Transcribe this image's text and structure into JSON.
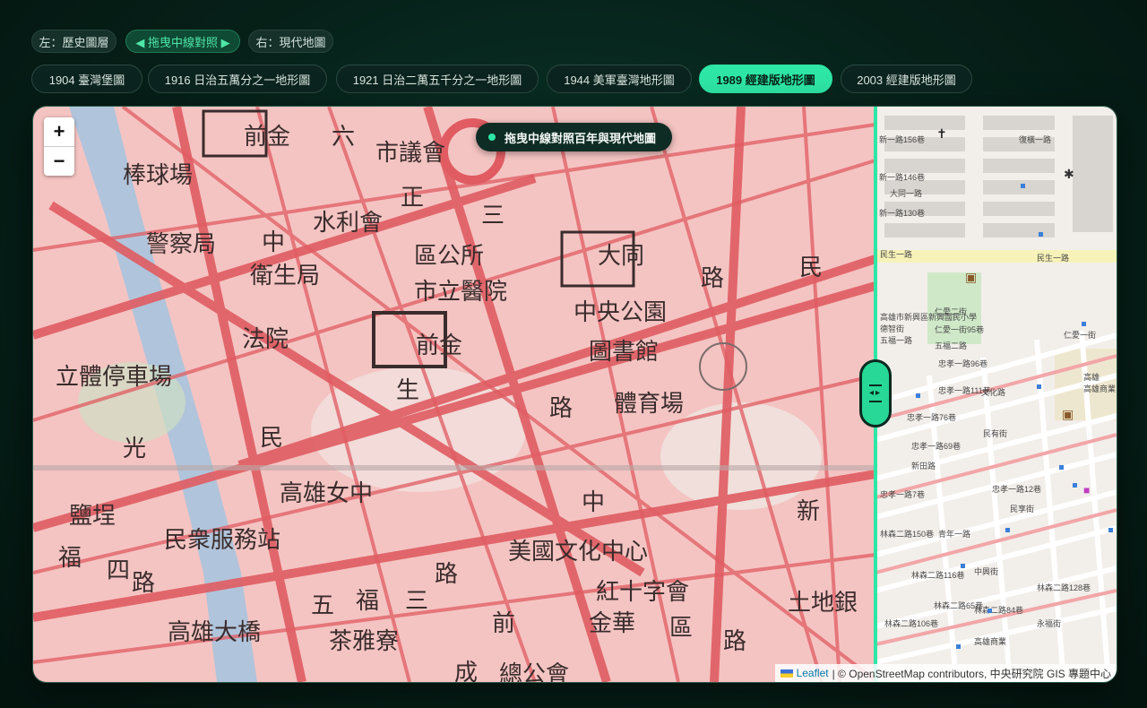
{
  "hints": {
    "left": "左：歷史圖層",
    "drag": "◀ 拖曳中線對照 ▶",
    "right": "右：現代地圖"
  },
  "tabs": [
    {
      "label": "1904 臺灣堡圖",
      "active": false
    },
    {
      "label": "1916 日治五萬分之一地形圖",
      "active": false
    },
    {
      "label": "1921 日治二萬五千分之一地形圖",
      "active": false
    },
    {
      "label": "1944 美軍臺灣地形圖",
      "active": false
    },
    {
      "label": "1989 經建版地形圖",
      "active": true
    },
    {
      "label": "2003 經建版地形圖",
      "active": false
    }
  ],
  "map": {
    "title": "拖曳中線對照百年與現代地圖",
    "zoom_in": "+",
    "zoom_out": "−",
    "accent": "#2ee6a6",
    "attribution": {
      "leaflet": "Leaflet",
      "rest": "| © OpenStreetMap contributors, 中央研究院 GIS 專題中心"
    },
    "historic_labels": [
      "前金",
      "六",
      "市議會",
      "棒球場",
      "正",
      "水利會",
      "三",
      "警察局",
      "中",
      "區公所",
      "大同",
      "衛生局",
      "市立醫院",
      "路",
      "民",
      "中央公園",
      "法院",
      "前金",
      "圖書館",
      "立體停車場",
      "生",
      "體育場",
      "路",
      "光",
      "民",
      "高雄女中",
      "鹽埕",
      "新",
      "民衆服務站",
      "美國文化中心",
      "中",
      "福",
      "四",
      "路",
      "紅十字會",
      "土地銀",
      "五",
      "福",
      "三",
      "路",
      "高雄大橋",
      "茶雅寮",
      "前",
      "金華",
      "區",
      "路",
      "成",
      "總公會"
    ],
    "modern_labels": [
      "新一路156巷",
      "復橫一路",
      "新一路146巷",
      "大同一路",
      "新一路130巷",
      "民生一路",
      "民生一路",
      "高雄市新興區新興國民小學",
      "德智街",
      "五福一路",
      "仁愛二街",
      "仁愛一街",
      "仁愛一街95巷",
      "五福二路",
      "忠孝一路96巷",
      "忠孝一路111巷",
      "文化路",
      "忠孝一路76巷",
      "忠孝一路69巷",
      "民有街",
      "新田路",
      "忠孝一路12巷",
      "忠孝一路7巷",
      "民享街",
      "青年一路",
      "林森二路150巷",
      "林森二路116巷",
      "中興街",
      "林森二路128巷",
      "林森二路65巷",
      "林森二路84巷",
      "林森二路106巷",
      "永福街",
      "高雄商業"
    ]
  }
}
